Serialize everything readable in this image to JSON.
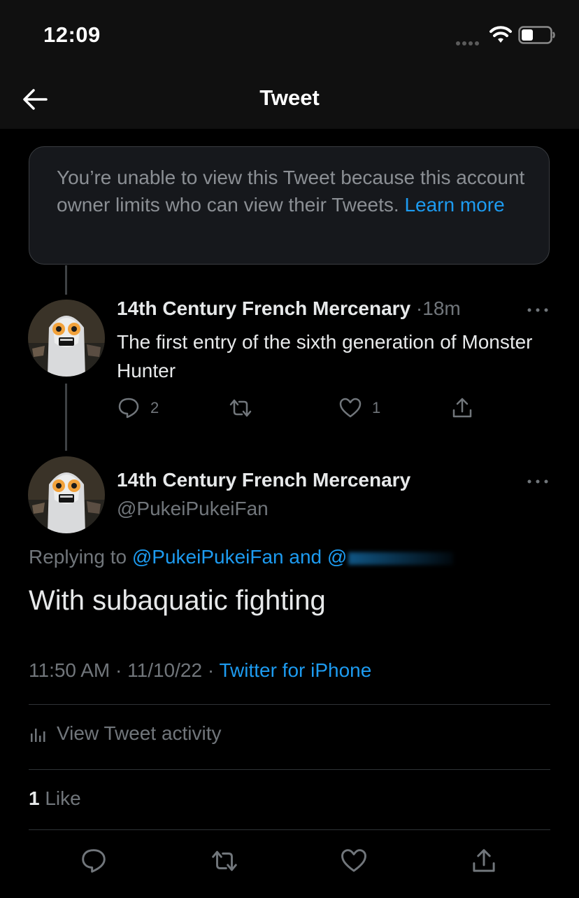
{
  "status_bar": {
    "time": "12:09"
  },
  "nav": {
    "title": "Tweet"
  },
  "unavailable": {
    "message": "You’re unable to view this Tweet because this account owner limits who can view their Tweets.",
    "link": "Learn more"
  },
  "parent_tweet": {
    "author": "14th Century French Mercenary",
    "separator": "·",
    "time": "18m",
    "text": "The first entry of the sixth generation of Monster Hunter",
    "replies": "2",
    "likes": "1"
  },
  "main_tweet": {
    "author": "14th Century French Mercenary",
    "handle": "@PukeiPukeiFan",
    "replying_label": "Replying to",
    "replying_to": "@PukeiPukeiFan and @",
    "text": "With subaquatic fighting",
    "time": "11:50 AM",
    "date": "11/10/22",
    "dot": "·",
    "source": "Twitter for iPhone",
    "activity_label": "View Tweet activity",
    "like_count": "1",
    "like_label": "Like"
  },
  "colors": {
    "accent": "#1d9bf0",
    "muted": "#71767b",
    "text": "#e7e9ea",
    "background": "#000000"
  }
}
